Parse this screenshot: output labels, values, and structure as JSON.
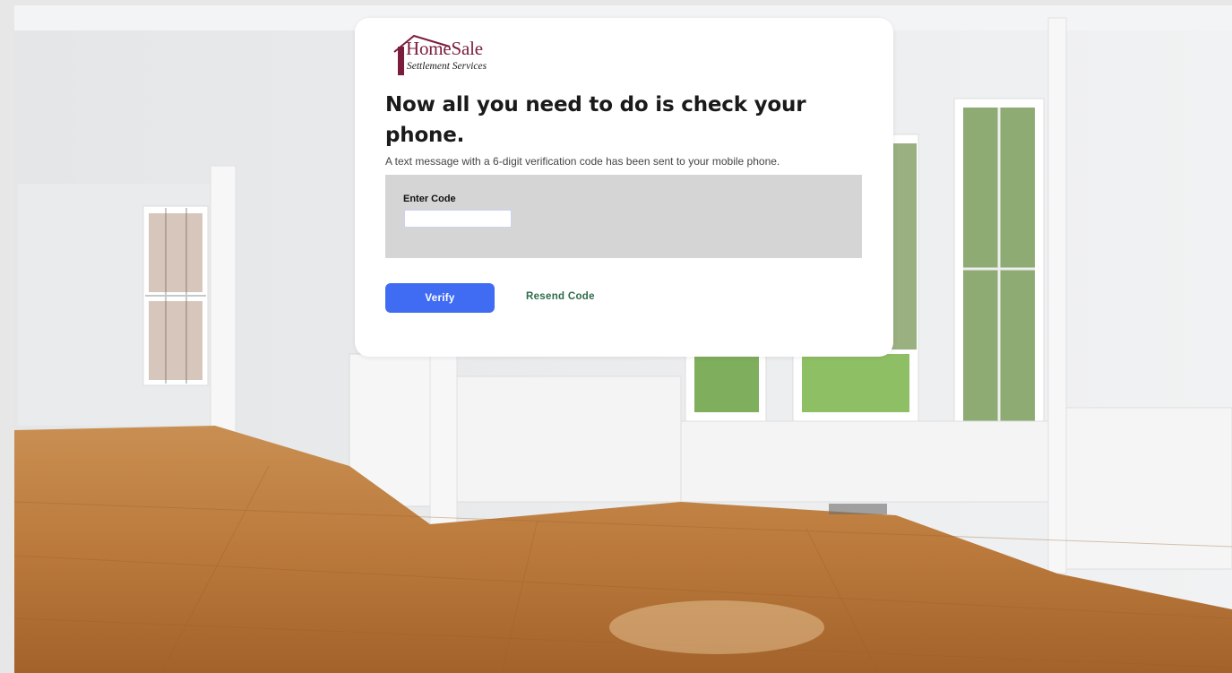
{
  "brand": {
    "name": "HomeSale",
    "tagline": "Settlement Services",
    "brand_color": "#7a1c3b",
    "logo_icon": "house-roof-icon"
  },
  "verification": {
    "headline": "Now all you need to do is check your phone.",
    "subtext": "A text message with a 6-digit verification code has been sent to your mobile phone.",
    "code_label": "Enter Code",
    "code_value": "",
    "verify_label": "Verify",
    "resend_label": "Resend Code",
    "verify_color": "#3f6cf2",
    "resend_color": "#2f6b4a"
  }
}
